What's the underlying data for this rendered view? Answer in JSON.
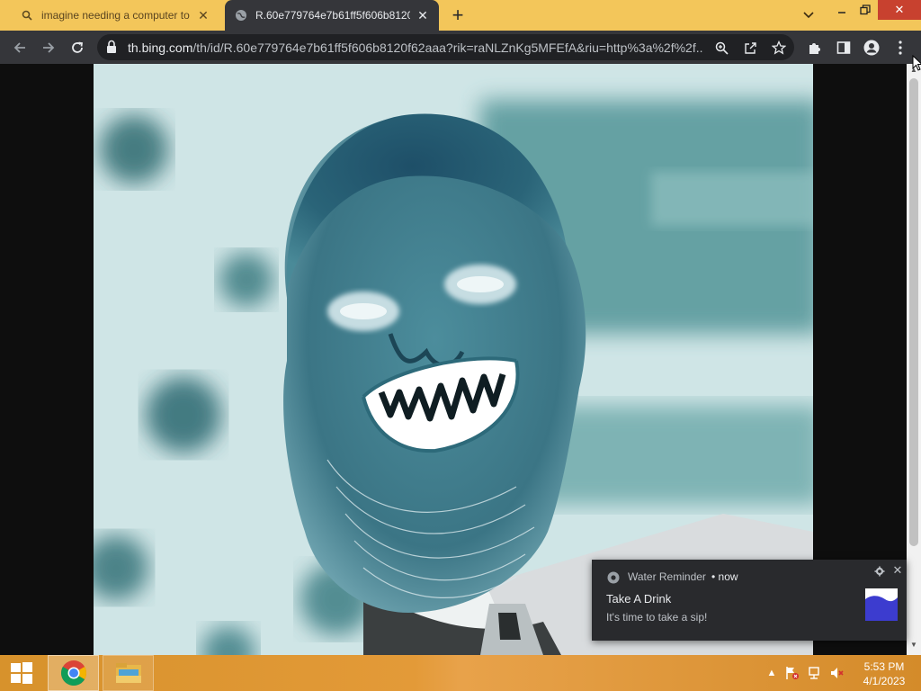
{
  "browser": {
    "tabs": [
      {
        "title": "imagine needing a computer to l",
        "favicon": "search-icon",
        "active": false
      },
      {
        "title": "R.60e779764e7b61ff5f606b8120f",
        "favicon": "globe-icon",
        "active": true
      }
    ],
    "address_bar": {
      "host": "th.bing.com",
      "path": "/th/id/R.60e779764e7b61ff5f606b8120f62aaa?rik=raNLZnKg5MFEfA&riu=http%3a%2f%2f..."
    }
  },
  "notification": {
    "app_name": "Water Reminder",
    "time": "now",
    "title": "Take A Drink",
    "body": "It's time to take a sip!"
  },
  "taskbar": {
    "clock_time": "5:53 PM",
    "clock_date": "4/1/2023"
  },
  "colors": {
    "tab_strip": "#f3c65a",
    "toolbar": "#35363a",
    "omnibox": "#202124",
    "close_button": "#c8412f",
    "taskbar": "#e39a38",
    "notification_bg": "#292a2d",
    "photo_teal": "#3d8088"
  }
}
